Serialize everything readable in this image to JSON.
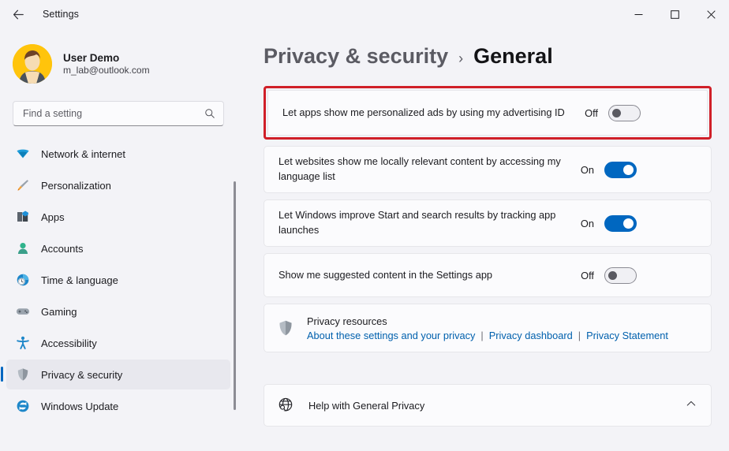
{
  "window": {
    "app_title": "Settings",
    "back_icon": "back-arrow-icon",
    "minimize_label": "Minimize",
    "maximize_label": "Maximize",
    "close_label": "Close"
  },
  "sidebar": {
    "profile": {
      "name": "User Demo",
      "email": "m_lab@outlook.com",
      "avatar_icon": "user-avatar"
    },
    "search": {
      "placeholder": "Find a setting",
      "value": "",
      "icon": "search-icon"
    },
    "items": [
      {
        "label": "Network & internet",
        "icon": "network-icon",
        "selected": false
      },
      {
        "label": "Personalization",
        "icon": "paintbrush-icon",
        "selected": false
      },
      {
        "label": "Apps",
        "icon": "apps-icon",
        "selected": false
      },
      {
        "label": "Accounts",
        "icon": "accounts-icon",
        "selected": false
      },
      {
        "label": "Time & language",
        "icon": "clock-icon",
        "selected": false
      },
      {
        "label": "Gaming",
        "icon": "gamepad-icon",
        "selected": false
      },
      {
        "label": "Accessibility",
        "icon": "accessibility-icon",
        "selected": false
      },
      {
        "label": "Privacy & security",
        "icon": "shield-icon",
        "selected": true
      },
      {
        "label": "Windows Update",
        "icon": "update-icon",
        "selected": false
      }
    ]
  },
  "content": {
    "breadcrumb": {
      "parent": "Privacy & security",
      "separator": "›",
      "current": "General"
    },
    "settings": [
      {
        "label": "Let apps show me personalized ads by using my advertising ID",
        "state": "Off",
        "on": false,
        "highlighted": true
      },
      {
        "label": "Let websites show me locally relevant content by accessing my language list",
        "state": "On",
        "on": true,
        "highlighted": false
      },
      {
        "label": "Let Windows improve Start and search results by tracking app launches",
        "state": "On",
        "on": true,
        "highlighted": false
      },
      {
        "label": "Show me suggested content in the Settings app",
        "state": "Off",
        "on": false,
        "highlighted": false
      }
    ],
    "resources": {
      "icon": "shield-icon",
      "title": "Privacy resources",
      "links": [
        "About these settings and your privacy",
        "Privacy dashboard",
        "Privacy Statement"
      ],
      "separator": "|"
    },
    "help": {
      "icon": "globe-help-icon",
      "label": "Help with General Privacy",
      "chevron_icon": "chevron-up-icon"
    }
  },
  "colors": {
    "accent": "#0067c0",
    "highlight": "#d01f28",
    "link": "#0060ad",
    "page_bg": "#f3f3f7",
    "card_bg": "#fbfbfd"
  }
}
